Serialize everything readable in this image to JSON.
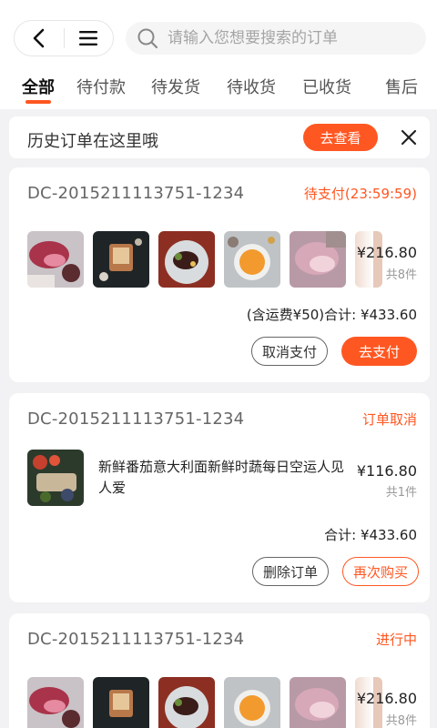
{
  "header": {
    "search_placeholder": "请输入您想要搜索的订单"
  },
  "tabs": [
    {
      "label": "全部"
    },
    {
      "label": "待付款"
    },
    {
      "label": "待发货"
    },
    {
      "label": "待收货"
    },
    {
      "label": "已收货"
    },
    {
      "label": "售后"
    }
  ],
  "banner": {
    "text": "历史订单在这里哦",
    "button_label": "去查看"
  },
  "orders": [
    {
      "order_no": "DC-2015211113751-1234",
      "status": "待支付(23:59:59)",
      "price": "¥216.80",
      "count": "共8件",
      "total": "(含运费¥50)合计: ¥433.60",
      "buttons": [
        "取消支付",
        "去支付"
      ]
    },
    {
      "order_no": "DC-2015211113751-1234",
      "status": "订单取消",
      "product_name": "新鲜番茄意大利面新鲜时蔬每日空运人见人爱",
      "price": "¥116.80",
      "count": "共1件",
      "total": "合计: ¥433.60",
      "buttons": [
        "删除订单",
        "再次购买"
      ]
    },
    {
      "order_no": "DC-2015211113751-1234",
      "status": "进行中",
      "price": "¥216.80",
      "count": "共8件"
    }
  ],
  "colors": {
    "accent": "#ff5722",
    "background": "#f2f2f4"
  },
  "icons": [
    "back-icon",
    "menu-icon",
    "search-icon",
    "close-icon"
  ]
}
